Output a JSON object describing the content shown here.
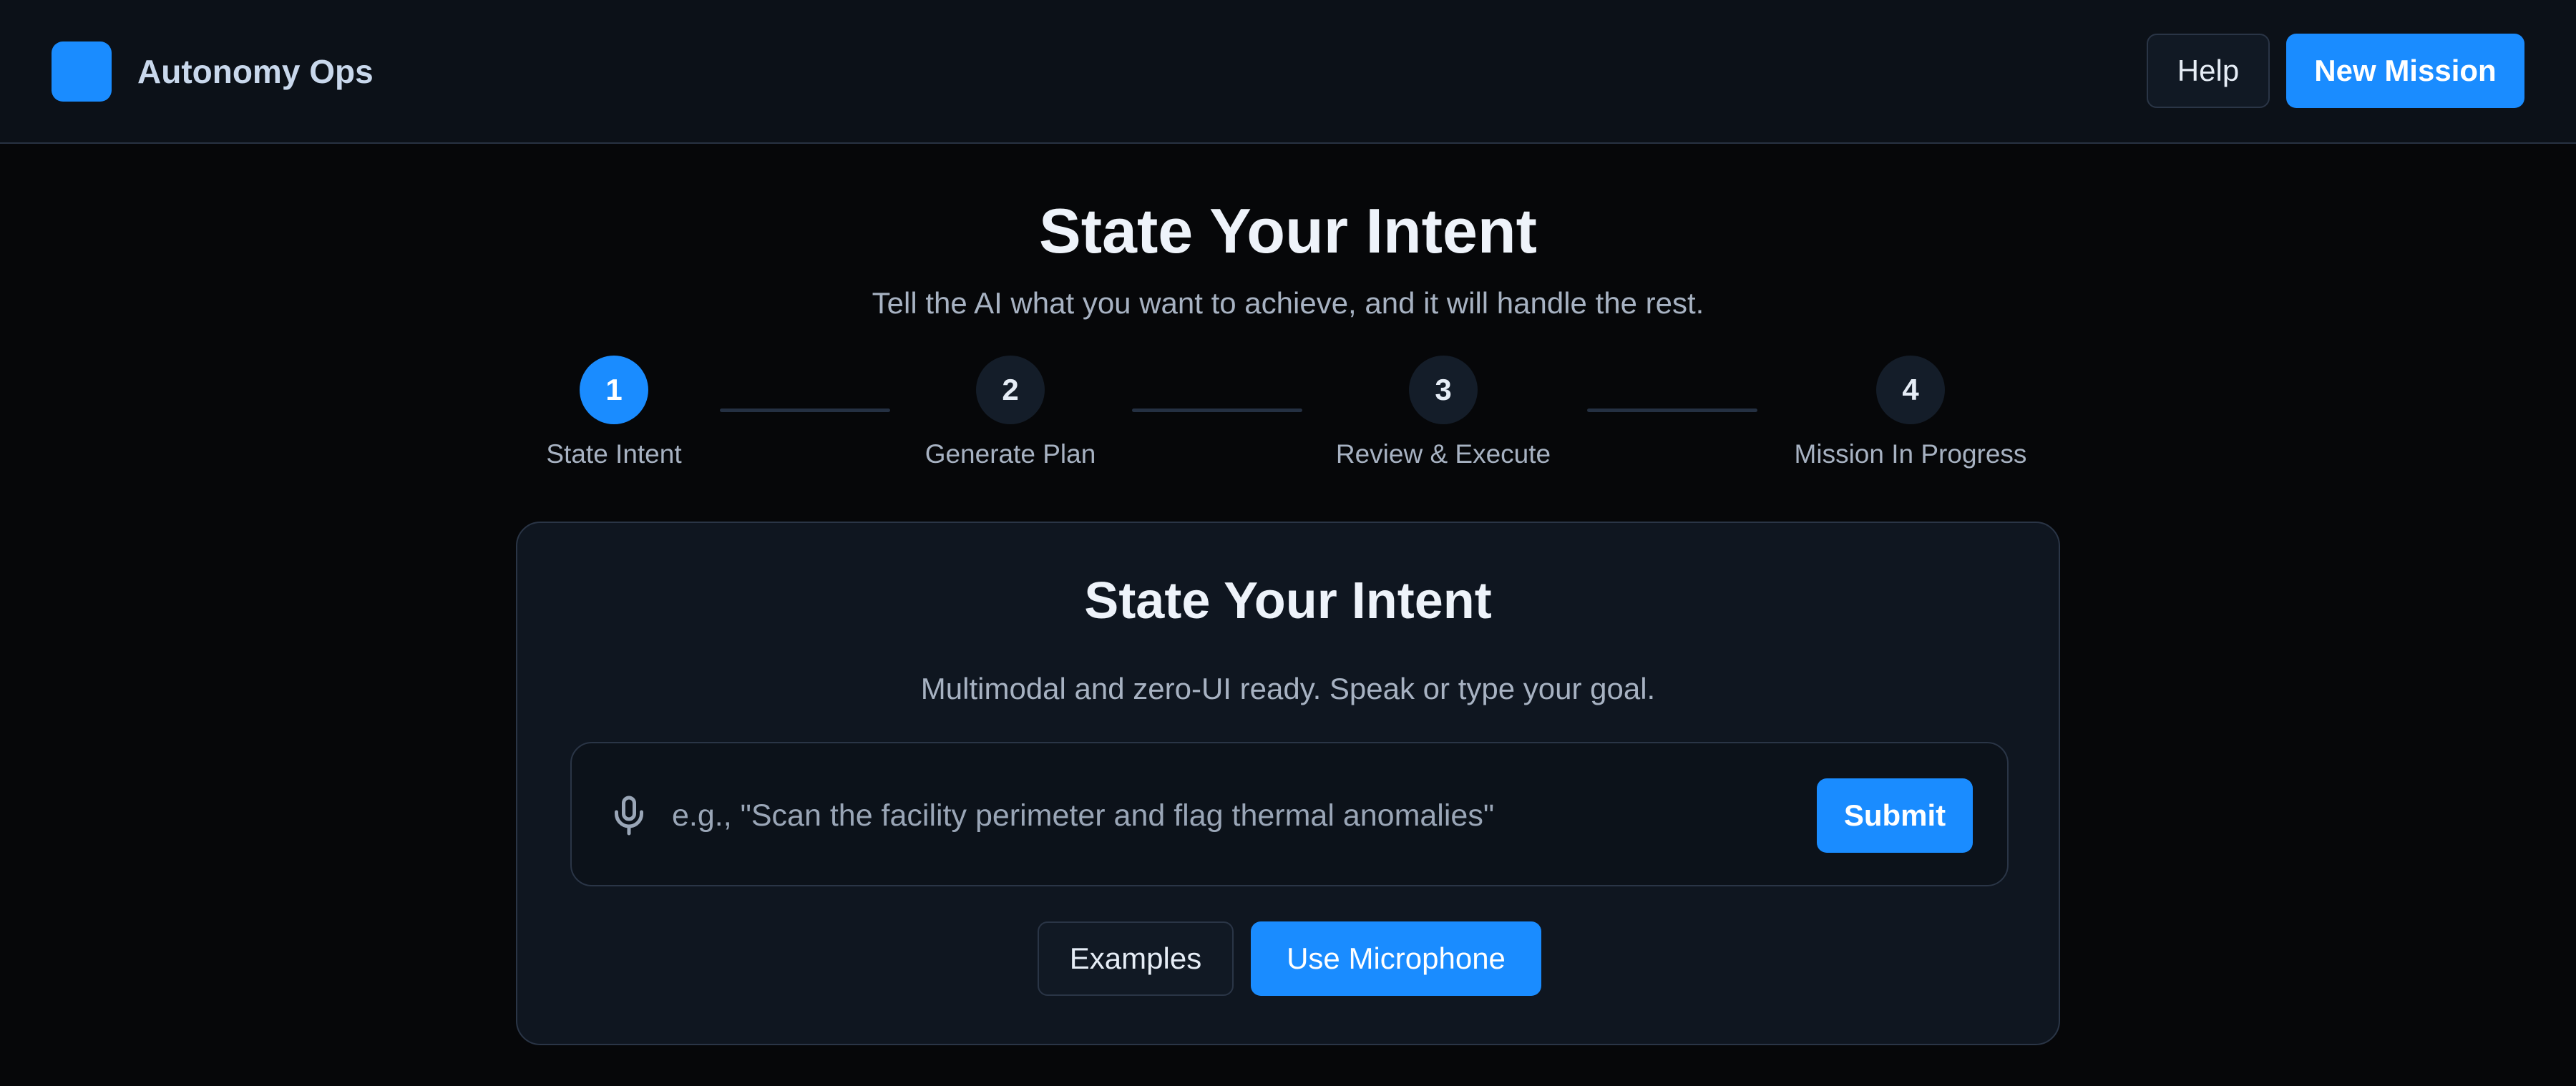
{
  "header": {
    "app_name": "Autonomy Ops",
    "help_label": "Help",
    "new_mission_label": "New Mission"
  },
  "page": {
    "title": "State Your Intent",
    "subtitle": "Tell the AI what you want to achieve, and it will handle the rest."
  },
  "steps": [
    {
      "number": "1",
      "label": "State Intent",
      "active": true
    },
    {
      "number": "2",
      "label": "Generate Plan",
      "active": false
    },
    {
      "number": "3",
      "label": "Review & Execute",
      "active": false
    },
    {
      "number": "4",
      "label": "Mission In Progress",
      "active": false
    }
  ],
  "card": {
    "title": "State Your Intent",
    "subtitle": "Multimodal and zero-UI ready. Speak or type your goal.",
    "input_value": "",
    "input_placeholder": "e.g., \"Scan the facility perimeter and flag thermal anomalies\"",
    "submit_label": "Submit",
    "examples_label": "Examples",
    "microphone_label": "Use Microphone"
  },
  "icons": {
    "mic": "microphone-icon",
    "logo": "app-logo"
  },
  "colors": {
    "accent": "#1a8cff",
    "background": "#060709",
    "surface": "#0f1620",
    "border": "#2a3546",
    "muted_text": "#a7b2c2"
  }
}
